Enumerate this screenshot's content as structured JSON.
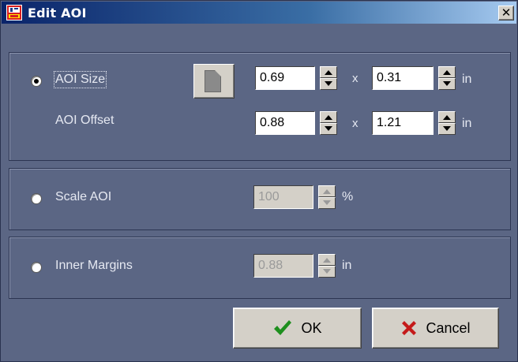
{
  "window": {
    "title": "Edit AOI",
    "close_icon": "close-icon",
    "app_icon": "aoi-app-icon"
  },
  "aoi_size_panel": {
    "aoi_size_label": "AOI Size",
    "aoi_size_selected": true,
    "page_button_icon": "page-icon",
    "width_value": "0.69",
    "height_value": "0.31",
    "times_sep": "x",
    "unit": "in",
    "aoi_offset_label": "AOI Offset",
    "offset_x_value": "0.88",
    "offset_y_value": "1.21"
  },
  "scale_panel": {
    "label": "Scale AOI",
    "selected": false,
    "value": "100",
    "unit": "%"
  },
  "margins_panel": {
    "label": "Inner Margins",
    "selected": false,
    "value": "0.88",
    "unit": "in"
  },
  "buttons": {
    "ok_label": "OK",
    "ok_icon": "checkmark-icon",
    "cancel_label": "Cancel",
    "cancel_icon": "x-icon"
  },
  "colors": {
    "dialog_bg": "#5b6684",
    "titlebar_start": "#0a246a",
    "titlebar_end": "#a6caf0",
    "ok_check": "#1e8f1e",
    "cancel_x": "#c41a1a"
  }
}
